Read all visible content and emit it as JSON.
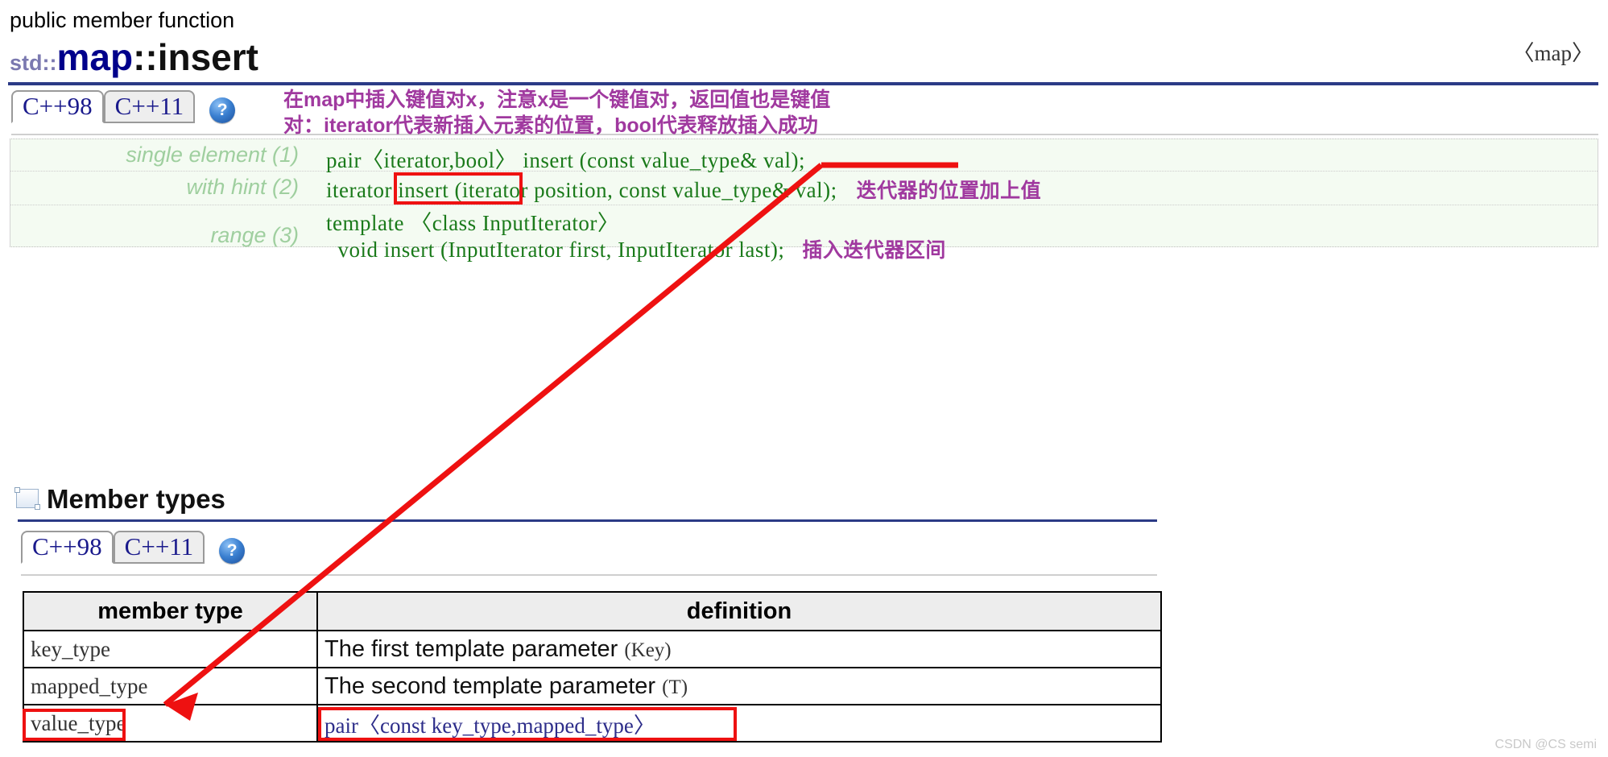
{
  "header": {
    "kind": "public member function",
    "std_prefix": "std::",
    "class_name": "map",
    "separator": "::",
    "function_name": "insert",
    "include_header": "〈map〉"
  },
  "colors": {
    "accent_blue": "#2b3a86",
    "code_green": "#1a7a1a",
    "label_green": "#9fcf9f",
    "annotation_purple": "#a0399f",
    "annotation_red": "#ee1111",
    "class_blue": "#00008b"
  },
  "prototype_section": {
    "tabs": [
      {
        "label": "C++98",
        "active": true
      },
      {
        "label": "C++11",
        "active": false
      }
    ],
    "help_icon": "?",
    "annotation_lines": [
      "在map中插入键值对x，注意x是一个键值对，返回值也是键值",
      "对：iterator代表新插入元素的位置，bool代表释放插入成功"
    ],
    "rows": [
      {
        "label": "single element (1)",
        "code_boxed": "pair〈iterator,bool〉",
        "code_rest": " insert (const value_type& val);",
        "note": ""
      },
      {
        "label": "with hint (2)",
        "code_boxed": "",
        "code_rest": "iterator insert (iterator position, const value_type& val);",
        "note": "迭代器的位置加上值"
      },
      {
        "label": "range (3)",
        "code_boxed": "",
        "code_line1": "template 〈class InputIterator〉",
        "code_line2": "  void insert (InputIterator first, InputIterator last);",
        "note": "插入迭代器区间"
      }
    ]
  },
  "member_types_section": {
    "heading": "Member types",
    "tabs": [
      {
        "label": "C++98",
        "active": true
      },
      {
        "label": "C++11",
        "active": false
      }
    ],
    "help_icon": "?",
    "columns": [
      "member type",
      "definition"
    ],
    "rows": [
      {
        "member_type": "key_type",
        "definition_text": "The first template parameter ",
        "definition_code": "(Key)",
        "highlighted_member": false,
        "highlighted_definition": false
      },
      {
        "member_type": "mapped_type",
        "definition_text": "The second template parameter ",
        "definition_code": "(T)",
        "highlighted_member": false,
        "highlighted_definition": false
      },
      {
        "member_type": "value_type",
        "definition_text": "",
        "definition_code": "pair〈const key_type,mapped_type〉",
        "highlighted_member": true,
        "highlighted_definition": true
      }
    ]
  },
  "watermark": "CSDN @CS semi"
}
